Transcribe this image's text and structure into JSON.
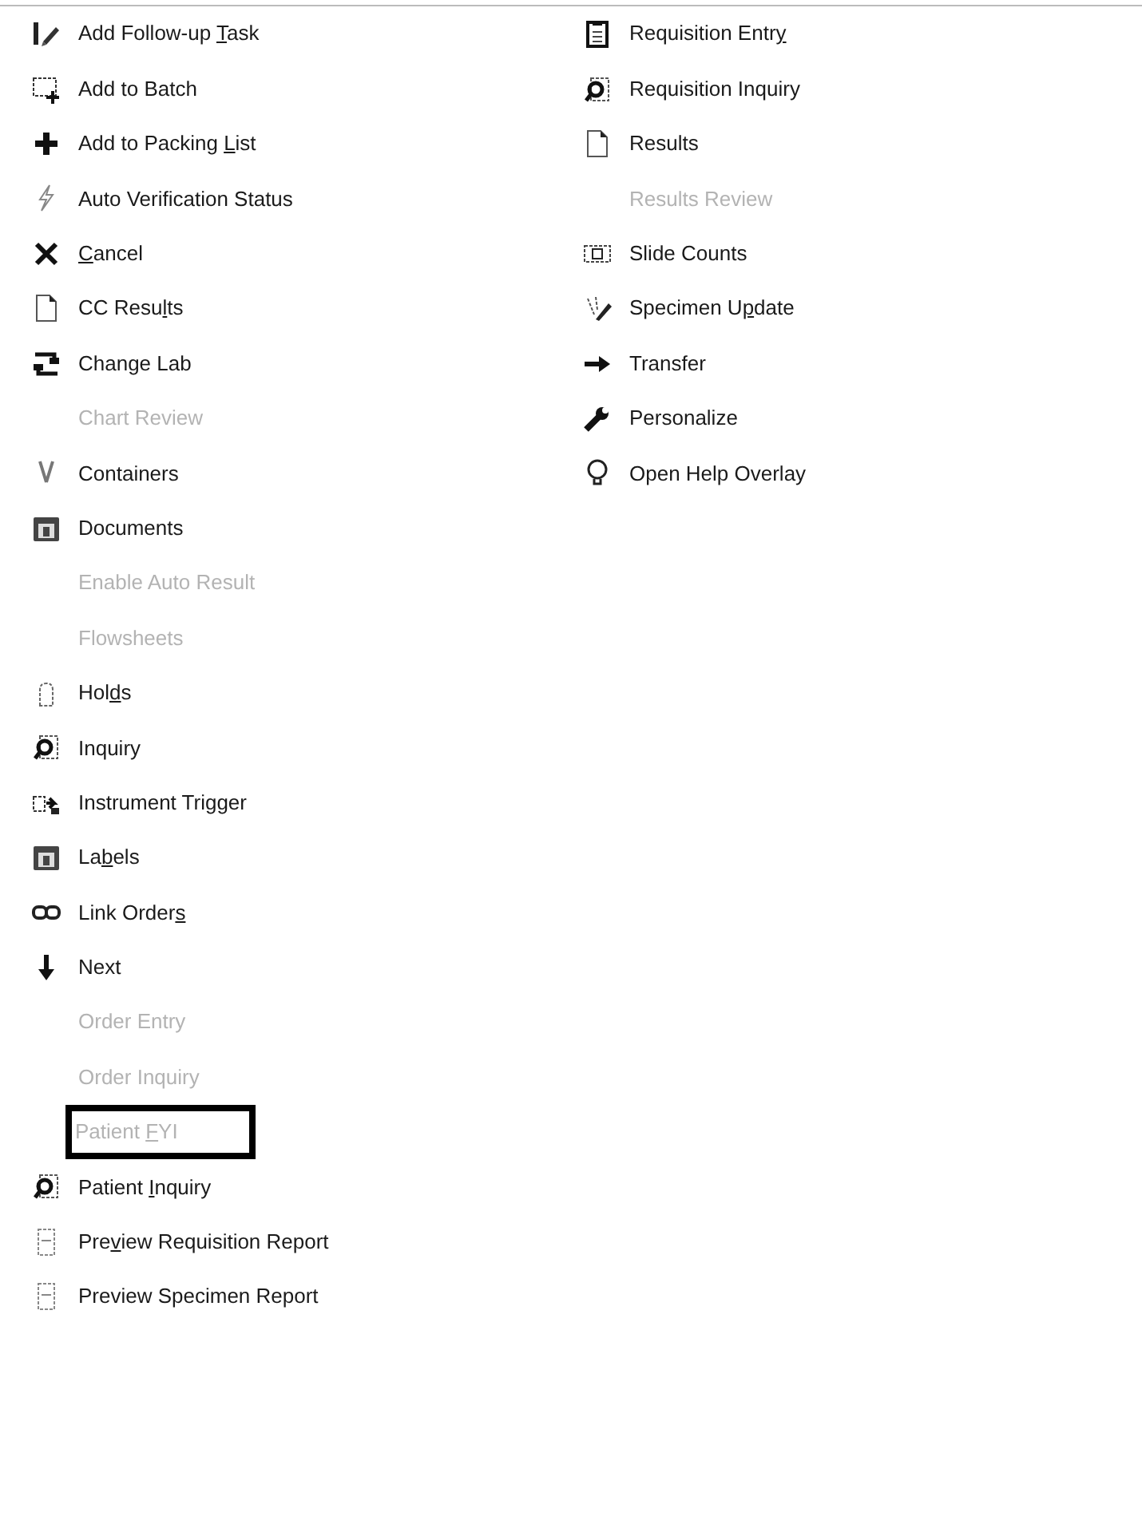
{
  "menu": {
    "columns": [
      {
        "items": [
          {
            "label_start": "Add Follow-up ",
            "mnemonic": "T",
            "label_end": "ask",
            "disabled": false,
            "outlined": false
          },
          {
            "label_start": "Add to Batch",
            "disabled": false,
            "outlined": false
          },
          {
            "label_start": "Add to Packing ",
            "mnemonic": "L",
            "label_end": "ist",
            "disabled": false,
            "outlined": false
          },
          {
            "label_start": "Auto Verification Status",
            "disabled": false,
            "outlined": false
          },
          {
            "mnemonic": "C",
            "label_end": "ancel",
            "disabled": false,
            "outlined": false
          },
          {
            "label_start": "CC Resu",
            "mnemonic": "l",
            "label_end": "ts",
            "disabled": false,
            "outlined": false
          },
          {
            "label_start": "Change Lab",
            "disabled": false,
            "outlined": false
          },
          {
            "label_start": "Chart Review",
            "disabled": true,
            "outlined": false
          },
          {
            "label_start": "Containers",
            "disabled": false,
            "outlined": false
          },
          {
            "label_start": "Documents",
            "disabled": false,
            "outlined": false
          },
          {
            "label_start": "Enable Auto Result",
            "disabled": true,
            "outlined": false
          },
          {
            "label_start": "Flowsheets",
            "disabled": true,
            "outlined": false
          },
          {
            "label_start": "Hol",
            "mnemonic": "d",
            "label_end": "s",
            "disabled": false,
            "outlined": false
          },
          {
            "label_start": "Inquiry",
            "disabled": false,
            "outlined": false
          },
          {
            "label_start": "Instrument Trigger",
            "disabled": false,
            "outlined": false
          },
          {
            "label_start": "La",
            "mnemonic": "b",
            "label_end": "els",
            "disabled": false,
            "outlined": false
          },
          {
            "label_start": "Link Order",
            "mnemonic": "s",
            "disabled": false,
            "outlined": false
          },
          {
            "label_start": "Next",
            "disabled": false,
            "outlined": false
          },
          {
            "label_start": "Order Entry",
            "disabled": true,
            "outlined": false
          },
          {
            "label_start": "Order Inquiry",
            "disabled": true,
            "outlined": false
          },
          {
            "label_start": "Patient ",
            "mnemonic": "F",
            "label_end": "YI",
            "disabled": true,
            "outlined": true
          },
          {
            "label_start": "Patient ",
            "mnemonic": "I",
            "label_end": "nquiry",
            "disabled": false,
            "outlined": false
          },
          {
            "label_start": "Pre",
            "mnemonic": "v",
            "label_end": "iew Requisition Report",
            "disabled": false,
            "outlined": false
          },
          {
            "label_start": "Preview Specimen Report",
            "disabled": false,
            "outlined": false
          }
        ]
      },
      {
        "items": [
          {
            "label_start": "Requisition Entr",
            "mnemonic": "y",
            "disabled": false,
            "outlined": false
          },
          {
            "label_start": "Requisition Inquiry",
            "disabled": false,
            "outlined": false
          },
          {
            "label_start": "Results",
            "disabled": false,
            "outlined": false
          },
          {
            "label_start": "Results Review",
            "disabled": true,
            "outlined": false
          },
          {
            "label_start": "Slide Counts",
            "disabled": false,
            "outlined": false
          },
          {
            "label_start": "Specimen U",
            "mnemonic": "p",
            "label_end": "date",
            "disabled": false,
            "outlined": false
          },
          {
            "label_start": "Transfer",
            "disabled": false,
            "outlined": false
          },
          {
            "label_start": "Personalize",
            "disabled": false,
            "outlined": false
          },
          {
            "label_start": "Open Help Overlay",
            "disabled": false,
            "outlined": false
          }
        ]
      }
    ]
  }
}
